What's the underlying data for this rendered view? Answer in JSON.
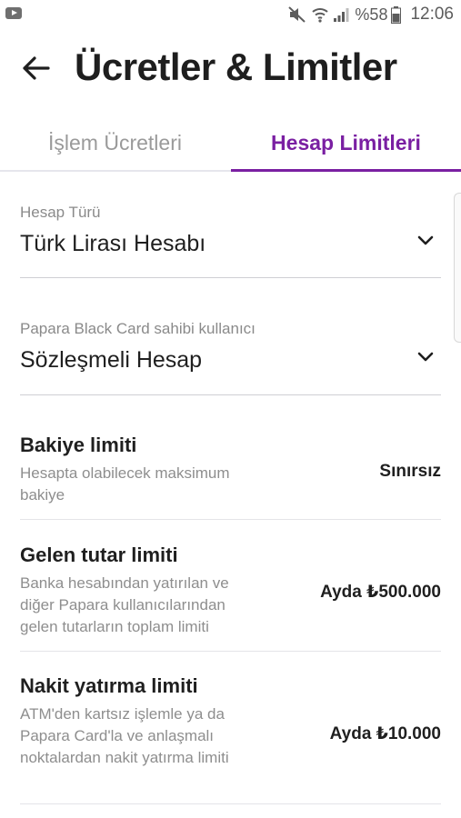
{
  "status_bar": {
    "battery_percent": "%58",
    "time": "12:06",
    "icons": [
      "youtube-notification-icon",
      "mute-icon",
      "wifi-icon",
      "signal-icon",
      "battery-icon"
    ]
  },
  "header": {
    "back_icon": "arrow-left-icon",
    "title": "Ücretler & Limitler"
  },
  "tabs": [
    {
      "label": "İşlem Ücretleri",
      "active": false
    },
    {
      "label": "Hesap Limitleri",
      "active": true
    }
  ],
  "colors": {
    "accent": "#7a1fa2",
    "inactive_tab": "#9a9a9a",
    "text": "#1f1f1f",
    "secondary_text": "#8e8e8e"
  },
  "fields": [
    {
      "label": "Hesap Türü",
      "value": "Türk Lirası Hesabı"
    },
    {
      "label": "Papara Black Card sahibi kullanıcı",
      "value": "Sözleşmeli Hesap"
    }
  ],
  "limits": [
    {
      "title": "Bakiye limiti",
      "description": "Hesapta olabilecek maksimum bakiye",
      "value": "Sınırsız"
    },
    {
      "title": "Gelen tutar limiti",
      "description": "Banka hesabından yatırılan ve diğer Papara kullanıcılarından gelen tutarların toplam limiti",
      "value": "Ayda ₺500.000"
    },
    {
      "title": "Nakit yatırma limiti",
      "description": "ATM'den kartsız işlemle ya da Papara Card'la ve anlaşmalı noktalardan nakit yatırma limiti",
      "value": "Ayda ₺10.000"
    }
  ]
}
